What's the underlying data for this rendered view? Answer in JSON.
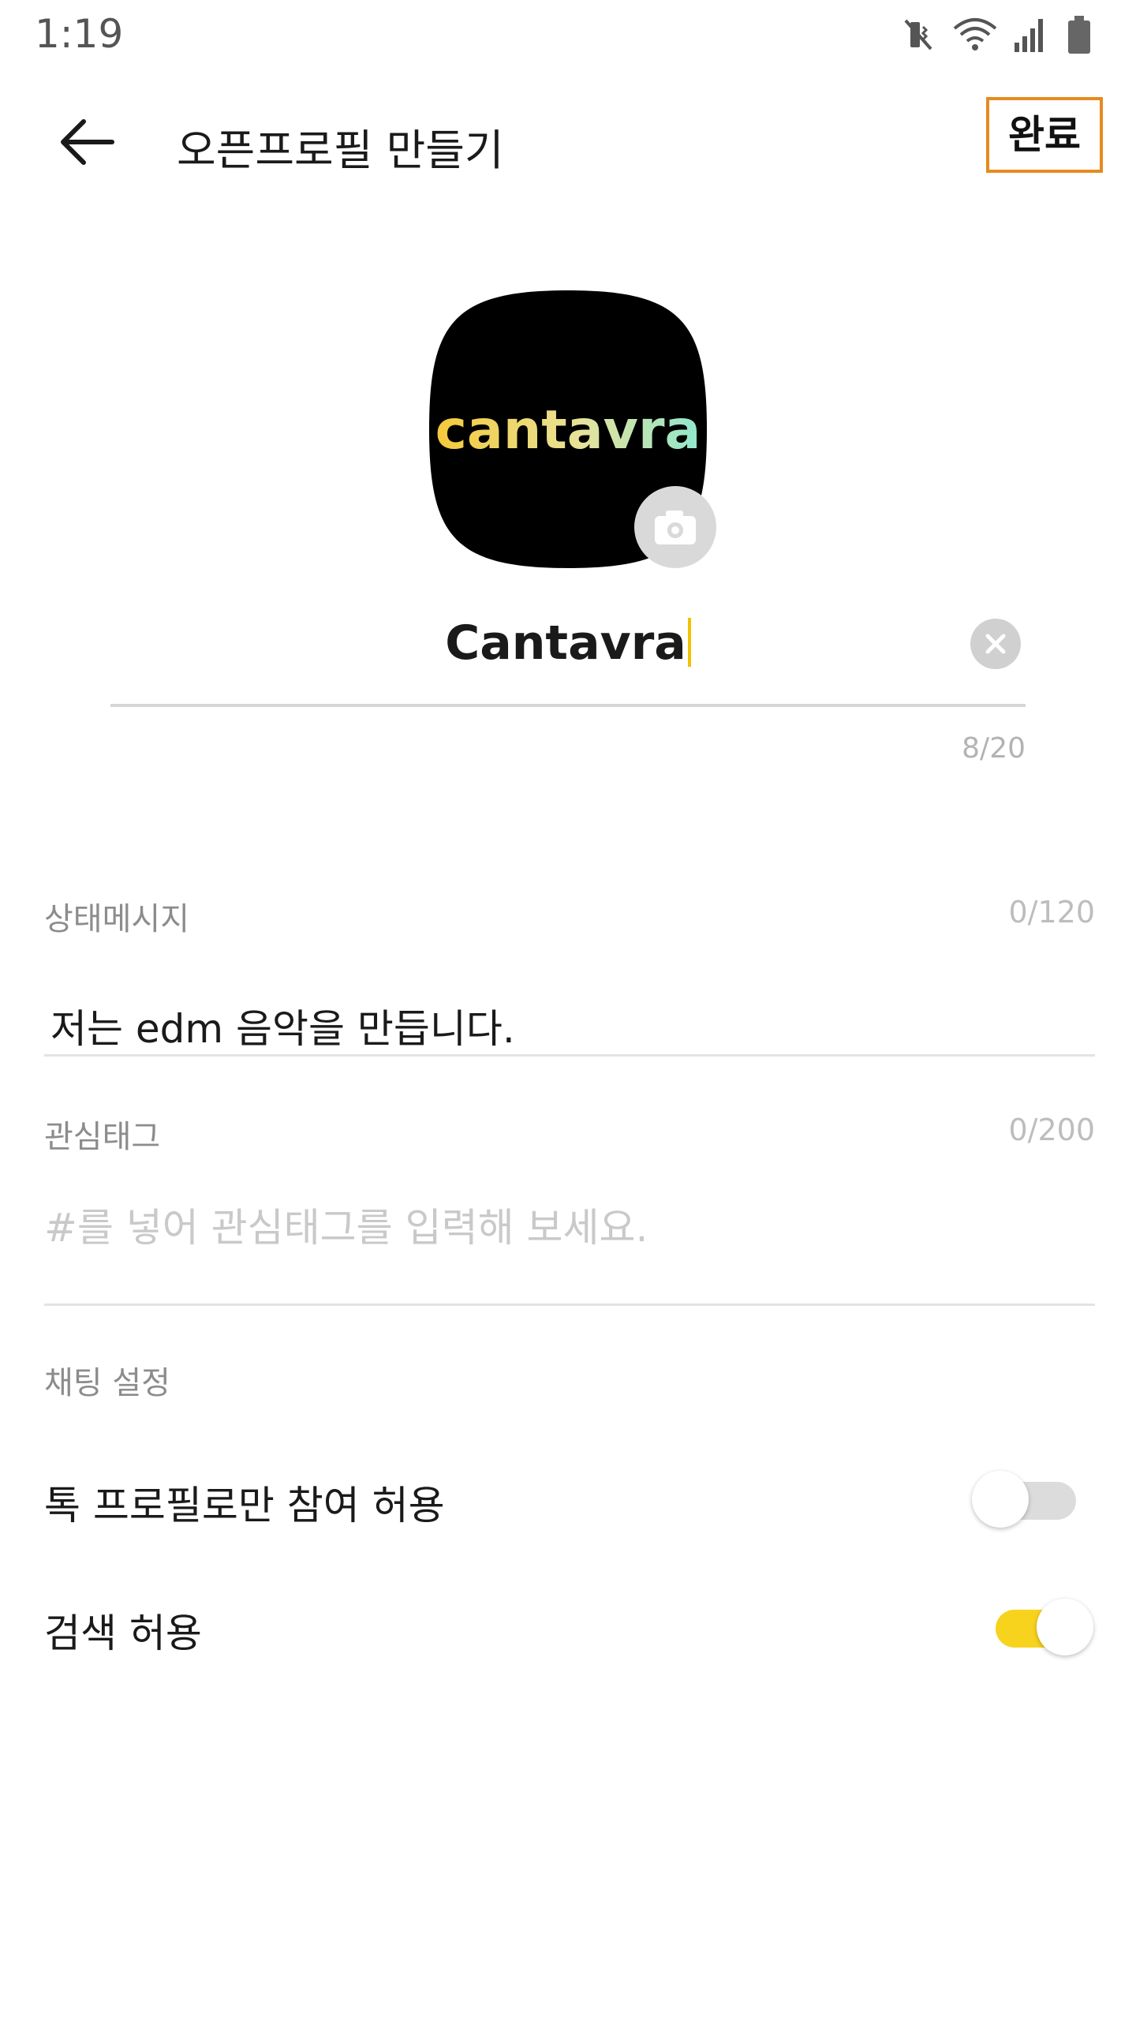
{
  "status_bar": {
    "time": "1:19",
    "icons": [
      "mute-vibrate-icon",
      "wifi-icon",
      "signal-icon",
      "battery-icon"
    ]
  },
  "app_bar": {
    "title": "오픈프로필 만들기",
    "back_icon": "back-arrow-icon",
    "done_label": "완료",
    "done_highlight_color": "#E68A1F"
  },
  "profile": {
    "logo_text": "cantavra",
    "camera_icon": "camera-icon"
  },
  "name_field": {
    "value": "Cantavra",
    "counter": "8/20",
    "clear_icon": "clear-icon",
    "cursor_color": "#F2C200"
  },
  "status_message": {
    "label": "상태메시지",
    "counter": "0/120",
    "value": "저는 edm 음악을 만듭니다."
  },
  "interest_tags": {
    "label": "관심태그",
    "counter": "0/200",
    "placeholder": "#를 넣어 관심태그를 입력해 보세요."
  },
  "chat_settings": {
    "section_label": "채팅 설정",
    "items": [
      {
        "label": "톡 프로필로만 참여 허용",
        "enabled": false
      },
      {
        "label": "검색 허용",
        "enabled": true
      }
    ],
    "accent_color": "#F7D31E"
  }
}
